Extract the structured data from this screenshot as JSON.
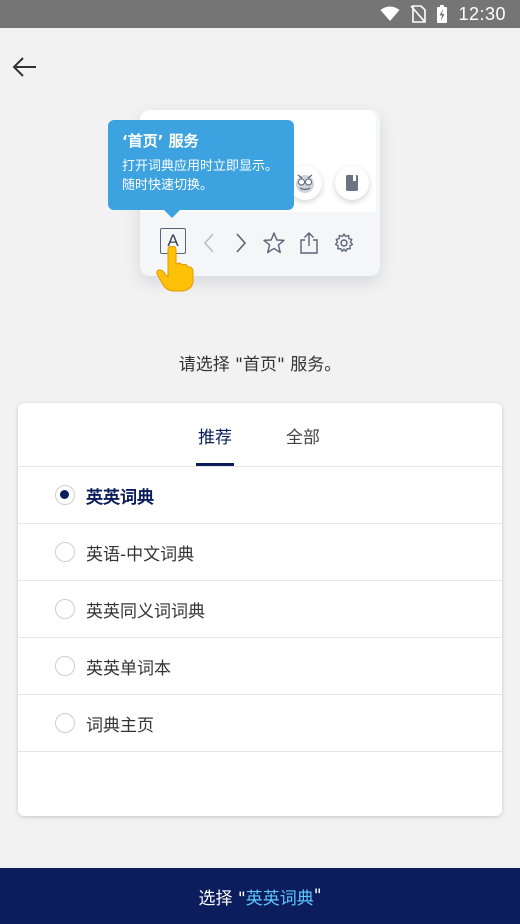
{
  "status_bar": {
    "time": "12:30",
    "icons": [
      "wifi-icon",
      "no-sim-icon",
      "battery-charging-icon"
    ]
  },
  "header": {
    "back_icon": "arrow-left-icon"
  },
  "tooltip": {
    "title": "‘首页’ 服务",
    "line1": "打开词典应用时立即显示。",
    "line2": "随时快速切换。"
  },
  "illustration": {
    "a_label": "A",
    "icons": [
      "owl-icon",
      "book-icon",
      "chevron-left-icon",
      "chevron-right-icon",
      "star-icon",
      "share-icon",
      "gear-icon",
      "pointing-hand-icon"
    ]
  },
  "prompt": "请选择 \"首页\" 服务。",
  "tabs": [
    {
      "label": "推荐",
      "active": true
    },
    {
      "label": "全部",
      "active": false
    }
  ],
  "options": [
    {
      "label": "英英词典",
      "checked": true
    },
    {
      "label": "英语-中文词典",
      "checked": false
    },
    {
      "label": "英英同义词词典",
      "checked": false
    },
    {
      "label": "英英单词本",
      "checked": false
    },
    {
      "label": "词典主页",
      "checked": false
    }
  ],
  "bottom_button": {
    "prefix": "选择 \"",
    "selected": "英英词典",
    "suffix": "\""
  },
  "colors": {
    "primary_navy": "#0b1d5c",
    "tooltip_blue": "#3da3e0",
    "accent_cyan": "#5ec8ff",
    "status_gray": "#757575"
  }
}
